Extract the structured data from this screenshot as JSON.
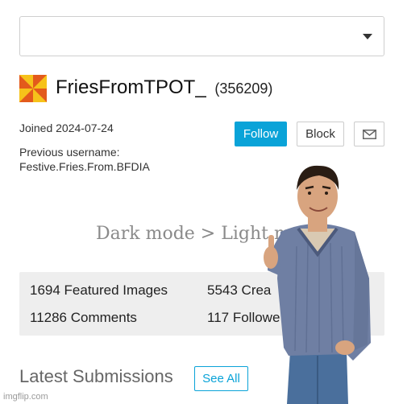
{
  "profile": {
    "username": "FriesFromTPOT_",
    "user_id": "(356209)",
    "joined": "Joined 2024-07-24",
    "previous_username_label": "Previous username:",
    "previous_username_value": "Festive.Fries.From.BFDIA"
  },
  "actions": {
    "follow_label": "Follow",
    "block_label": "Block",
    "message_icon": "envelope-icon"
  },
  "overlay": {
    "caption": "Dark mode > Light m"
  },
  "stats": {
    "featured_images": "1694 Featured Images",
    "creations": "5543 Crea",
    "comments": "11286 Comments",
    "followers": "117 Followe"
  },
  "submissions": {
    "heading": "Latest Submissions",
    "see_all_label": "See All"
  },
  "watermark": "imgflip.com",
  "colors": {
    "accent": "#0aa3d8",
    "avatar_orange": "#e35a1c",
    "avatar_yellow": "#f6c21a",
    "stats_background": "#eeeeee"
  }
}
